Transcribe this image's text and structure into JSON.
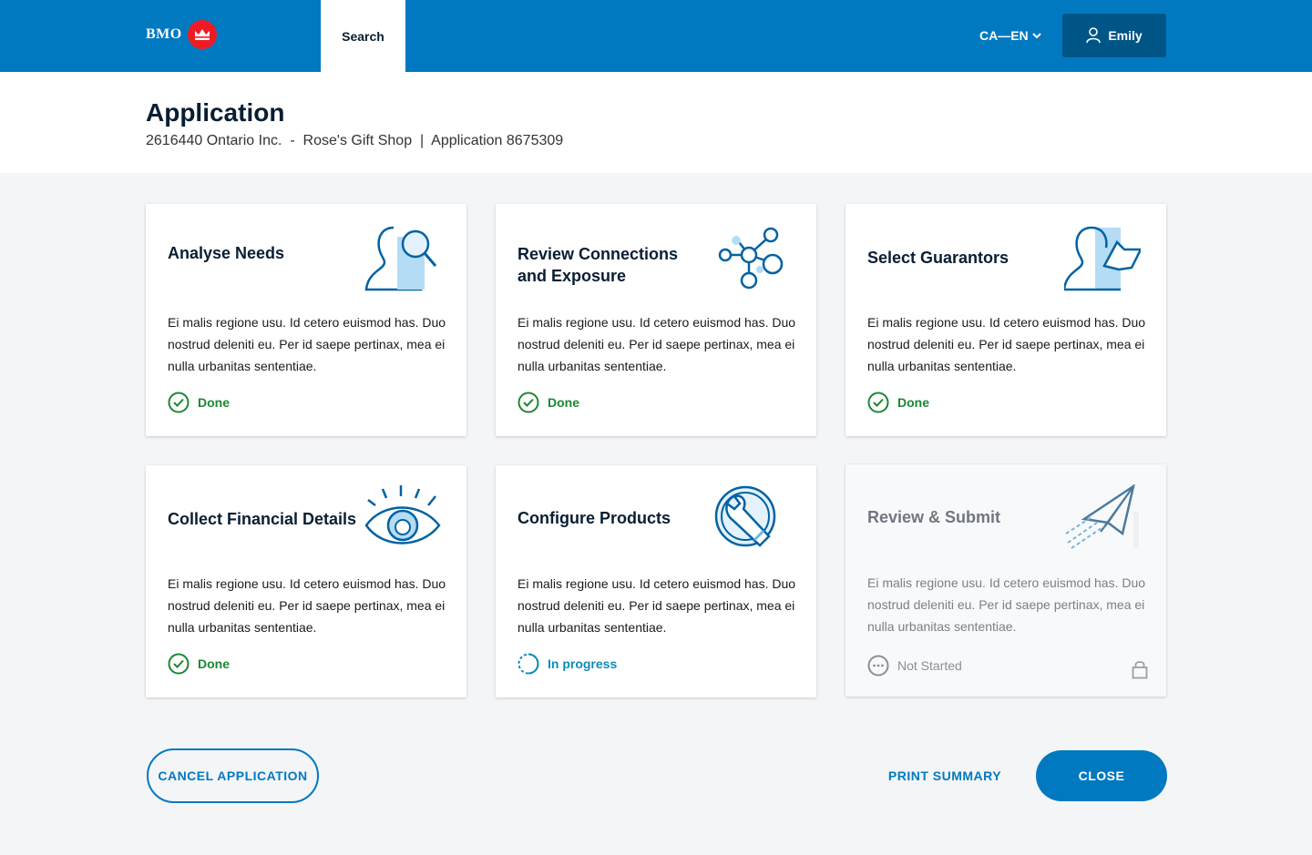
{
  "topbar": {
    "logo_text": "BMO",
    "search_tab": "Search",
    "language": "CA—EN",
    "user_name": "Emily"
  },
  "header": {
    "title": "Application",
    "subtitle": "2616440 Ontario Inc.  -  Rose's Gift Shop  |  Application 8675309"
  },
  "cards": [
    {
      "title": "Analyse Needs",
      "icon": "person-magnifier-icon",
      "description": "Ei malis regione usu. Id cetero euismod has. Duo nostrud deleniti eu. Per id saepe pertinax, mea ei nulla urbanitas sententiae.",
      "status": "Done"
    },
    {
      "title": "Review Connections and Exposure",
      "icon": "network-nodes-icon",
      "description": "Ei malis regione usu. Id cetero euismod has. Duo nostrud deleniti eu. Per id saepe pertinax, mea ei nulla urbanitas sententiae.",
      "status": "Done"
    },
    {
      "title": "Select Guarantors",
      "icon": "person-pointer-icon",
      "description": "Ei malis regione usu. Id cetero euismod has. Duo nostrud deleniti eu. Per id saepe pertinax, mea ei nulla urbanitas sententiae.",
      "status": "Done"
    },
    {
      "title": "Collect Financial Details",
      "icon": "eye-icon",
      "description": "Ei malis regione usu. Id cetero euismod has. Duo nostrud deleniti eu. Per id saepe pertinax, mea ei nulla urbanitas sententiae.",
      "status": "Done"
    },
    {
      "title": "Configure Products",
      "icon": "wrench-icon",
      "description": "Ei malis regione usu. Id cetero euismod has. Duo nostrud deleniti eu. Per id saepe pertinax, mea ei nulla urbanitas sententiae.",
      "status": "In progress"
    },
    {
      "title": "Review & Submit",
      "icon": "paper-plane-icon",
      "description": "Ei malis regione usu. Id cetero euismod has. Duo nostrud deleniti eu. Per id saepe pertinax, mea ei nulla urbanitas sententiae.",
      "status": "Not Started"
    }
  ],
  "actions": {
    "cancel": "CANCEL APPLICATION",
    "print": "PRINT SUMMARY",
    "close": "CLOSE"
  },
  "colors": {
    "brand_blue": "#0079c1",
    "brand_red": "#ed1c24",
    "done_green": "#1c8734",
    "progress_blue": "#0f8bb8"
  }
}
